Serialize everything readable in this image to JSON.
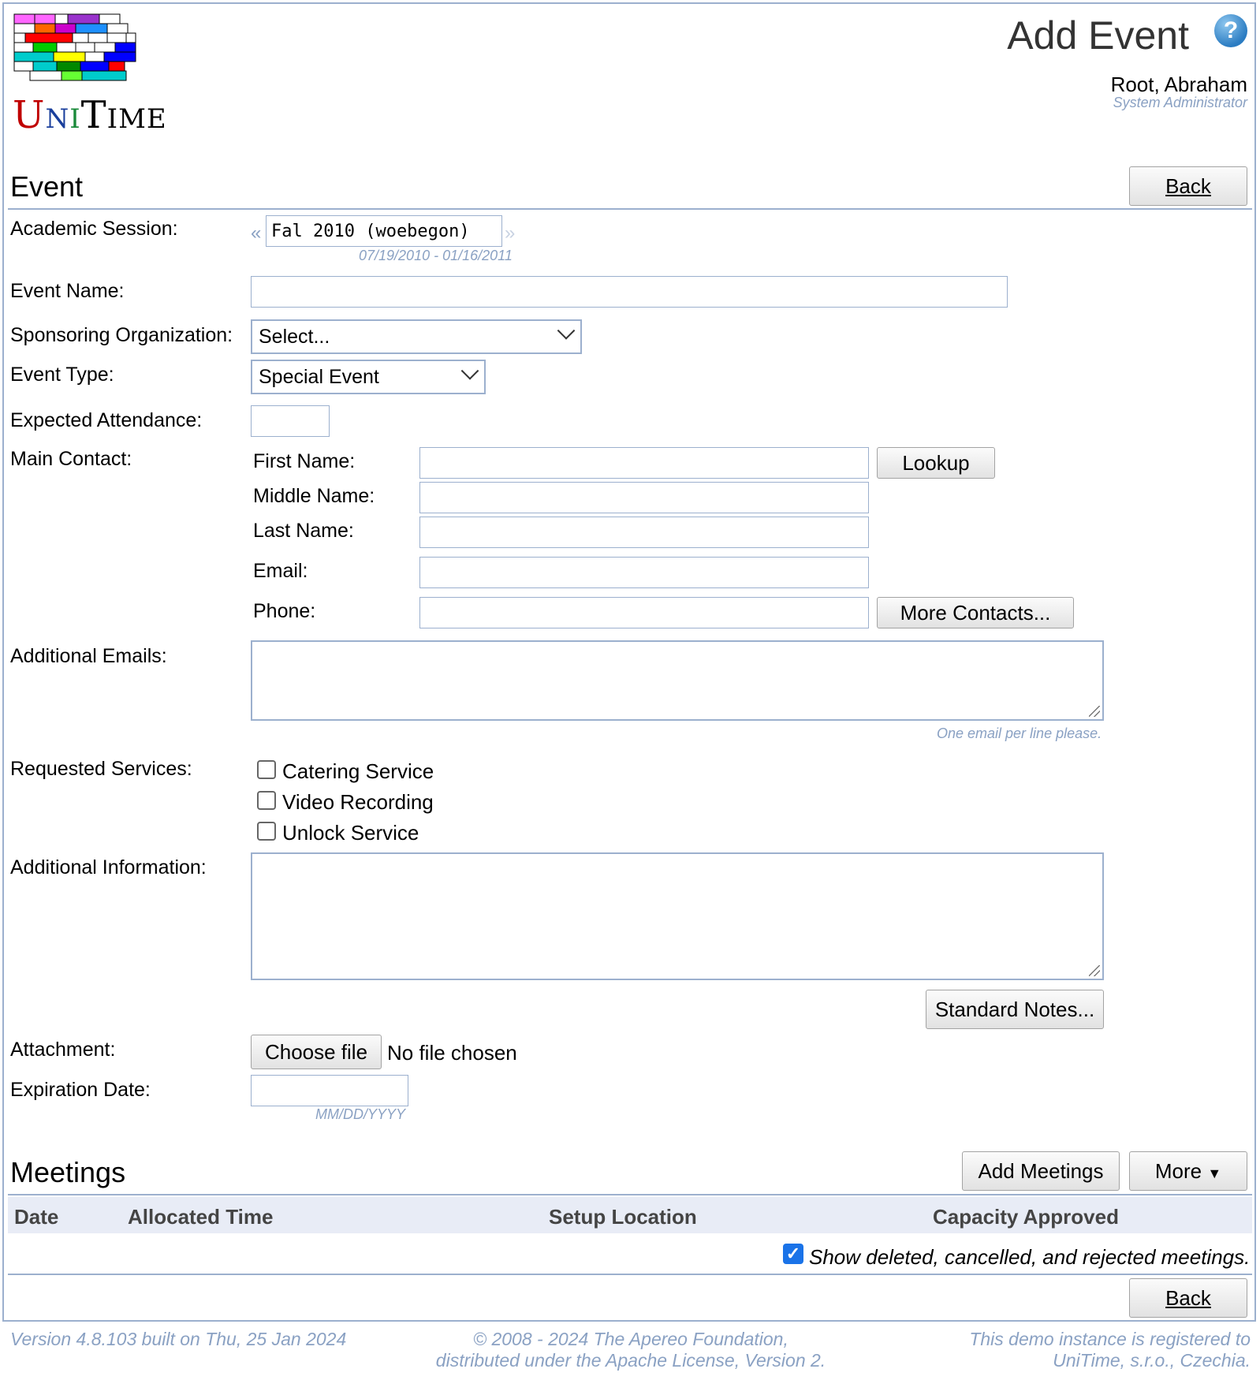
{
  "app": {
    "name": "UniTime"
  },
  "header": {
    "title": "Add Event",
    "user_name": "Root, Abraham",
    "user_role": "System Administrator"
  },
  "event_section": {
    "title": "Event",
    "back_label": "Back",
    "fields": {
      "academic_session_label": "Academic Session:",
      "academic_session_value": "Fal 2010 (woebegon)",
      "academic_session_dates": "07/19/2010 - 01/16/2011",
      "prev_arrow": "«",
      "next_arrow": "»",
      "event_name_label": "Event Name:",
      "event_name_value": "",
      "sponsoring_org_label": "Sponsoring Organization:",
      "sponsoring_org_value": "Select...",
      "event_type_label": "Event Type:",
      "event_type_value": "Special Event",
      "expected_attendance_label": "Expected Attendance:",
      "main_contact_label": "Main Contact:",
      "first_name_label": "First Name:",
      "middle_name_label": "Middle Name:",
      "last_name_label": "Last Name:",
      "email_label": "Email:",
      "phone_label": "Phone:",
      "lookup_label": "Lookup",
      "more_contacts_label": "More Contacts...",
      "additional_emails_label": "Additional Emails:",
      "additional_emails_hint": "One email per line please.",
      "requested_services_label": "Requested Services:",
      "services": [
        {
          "label": "Catering Service",
          "checked": false
        },
        {
          "label": "Video Recording",
          "checked": false
        },
        {
          "label": "Unlock Service",
          "checked": false
        }
      ],
      "additional_info_label": "Additional Information:",
      "standard_notes_label": "Standard Notes...",
      "attachment_label": "Attachment:",
      "choose_file_label": "Choose file",
      "no_file_label": "No file chosen",
      "expiration_date_label": "Expiration Date:",
      "expiration_date_hint": "MM/DD/YYYY"
    }
  },
  "meetings_section": {
    "title": "Meetings",
    "add_meetings_label": "Add Meetings",
    "more_label": "More",
    "more_arrow": "▼",
    "columns": [
      "Date",
      "Allocated Time",
      "Setup Location",
      "Capacity Approved"
    ],
    "show_deleted_label": "Show deleted, cancelled, and rejected meetings.",
    "show_deleted_checked": true,
    "back_label": "Back"
  },
  "footer": {
    "version": "Version 4.8.103 built on Thu, 25 Jan 2024",
    "copyright_line1": "© 2008 - 2024 The Apereo Foundation,",
    "copyright_line2": "distributed under the Apache License, Version 2.",
    "registration_line1": "This demo instance is registered to",
    "registration_line2": "UniTime, s.r.o., Czechia."
  },
  "colors": {
    "border": "#9cb0ce",
    "hint": "#8aa1c3",
    "table_header_bg": "#e8ecf6",
    "checkbox_checked": "#1a73e8"
  }
}
